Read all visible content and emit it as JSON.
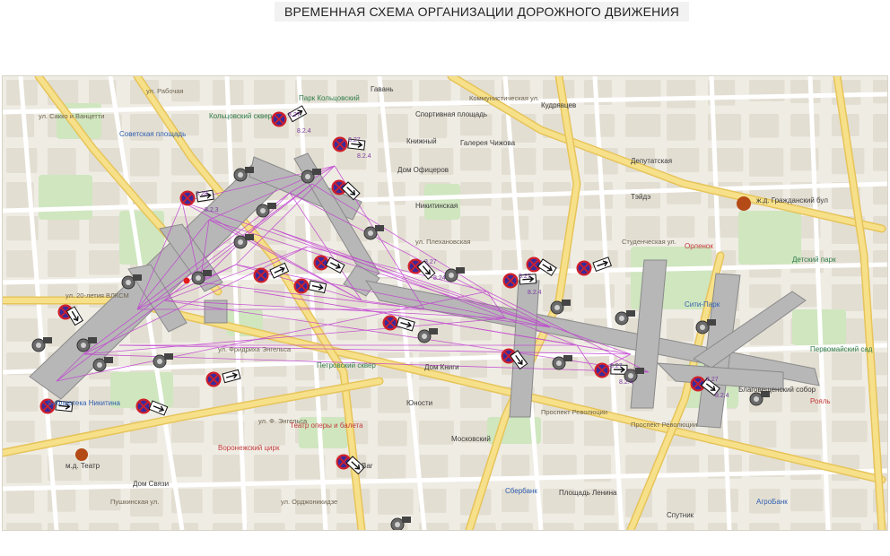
{
  "title": "ВРЕМЕННАЯ СХЕМА  ОРГАНИЗАЦИИ ДОРОЖНОГО ДВИЖЕНИЯ",
  "colors": {
    "map_background": "#efece4",
    "block": "#e3ded2",
    "park": "#cfe6bf",
    "minor_street": "#ffffff",
    "main_road": "#f7e08a",
    "main_road_edge": "#e6c45a",
    "closed_zone": "#b7b7b7",
    "detour_line": "#c040d0",
    "sign_no_stopping": "#3b2a9a",
    "sign_border": "#d0202a",
    "sign_arrow": "#111111"
  },
  "icons": {
    "sign": "no-stopping-sign-icon",
    "arrow_sign": "direction-arrow-sign-icon",
    "camera": "tripod-camera-icon",
    "marker": "red-dot-marker-icon"
  },
  "map_labels": [
    {
      "text": "ул. Сакко и Ванцетти",
      "kind": "street"
    },
    {
      "text": "ул. Рабочая",
      "kind": "street"
    },
    {
      "text": "Коммунистическая ул.",
      "kind": "street"
    },
    {
      "text": "Студенческая ул.",
      "kind": "street"
    },
    {
      "text": "Проспект Революции",
      "kind": "street"
    },
    {
      "text": "Проспект Революции",
      "kind": "street"
    },
    {
      "text": "ул. Плехановская",
      "kind": "street"
    },
    {
      "text": "ул. Фридриха Энгельса",
      "kind": "street"
    },
    {
      "text": "ул. Ф. Энгельса",
      "kind": "street"
    },
    {
      "text": "ул. 20-летия ВЛКСМ",
      "kind": "street"
    },
    {
      "text": "ул. Орджоникидзе",
      "kind": "street"
    },
    {
      "text": "Пушкинская ул.",
      "kind": "street"
    },
    {
      "text": "Гавань",
      "kind": "poi"
    },
    {
      "text": "Спортивная площадь",
      "kind": "poi"
    },
    {
      "text": "Кудрявцев",
      "kind": "poi"
    },
    {
      "text": "Галерея Чижова",
      "kind": "poi"
    },
    {
      "text": "Книжный",
      "kind": "poi"
    },
    {
      "text": "Парк Кольцовский",
      "kind": "green"
    },
    {
      "text": "Кольцовский сквер",
      "kind": "green"
    },
    {
      "text": "Никитинская",
      "kind": "poi"
    },
    {
      "text": "Дом Книги",
      "kind": "poi"
    },
    {
      "text": "Театр оперы и балета",
      "kind": "red"
    },
    {
      "text": "Петровский сквер",
      "kind": "green"
    },
    {
      "text": "Юности",
      "kind": "poi"
    },
    {
      "text": "Воронежский цирк",
      "kind": "red"
    },
    {
      "text": "Bar",
      "kind": "poi"
    },
    {
      "text": "Дом Офицеров",
      "kind": "poi"
    },
    {
      "text": "Советская площадь",
      "kind": "blue"
    },
    {
      "text": "Библиотека Никитина",
      "kind": "blue"
    },
    {
      "text": "Тэйдэ",
      "kind": "poi"
    },
    {
      "text": "Орленок",
      "kind": "red"
    },
    {
      "text": "Детский парк",
      "kind": "green"
    },
    {
      "text": "Сити-Парк",
      "kind": "blue"
    },
    {
      "text": "Московский",
      "kind": "poi"
    },
    {
      "text": "Спутник",
      "kind": "poi"
    },
    {
      "text": "АгроБанк",
      "kind": "blue"
    },
    {
      "text": "Сбербанк",
      "kind": "blue"
    },
    {
      "text": "Площадь Ленина",
      "kind": "poi"
    },
    {
      "text": "ж.д. Гражданский бул",
      "kind": "poi"
    },
    {
      "text": "м.д. Театр",
      "kind": "poi"
    },
    {
      "text": "Благовещенский собор",
      "kind": "poi"
    },
    {
      "text": "Первомайский сад",
      "kind": "green"
    },
    {
      "text": "Рояль",
      "kind": "red"
    },
    {
      "text": "Дом Связи",
      "kind": "poi"
    },
    {
      "text": "Депутатская",
      "kind": "poi"
    }
  ],
  "sign_labels": [
    "3.27",
    "8.2.4",
    "3.27",
    "8.2.4",
    "3.28",
    "8.2.3",
    "3.27",
    "8.24",
    "3.27",
    "8.2.4",
    "3.27",
    "8.2.4",
    "3.27",
    "8.2.4"
  ]
}
